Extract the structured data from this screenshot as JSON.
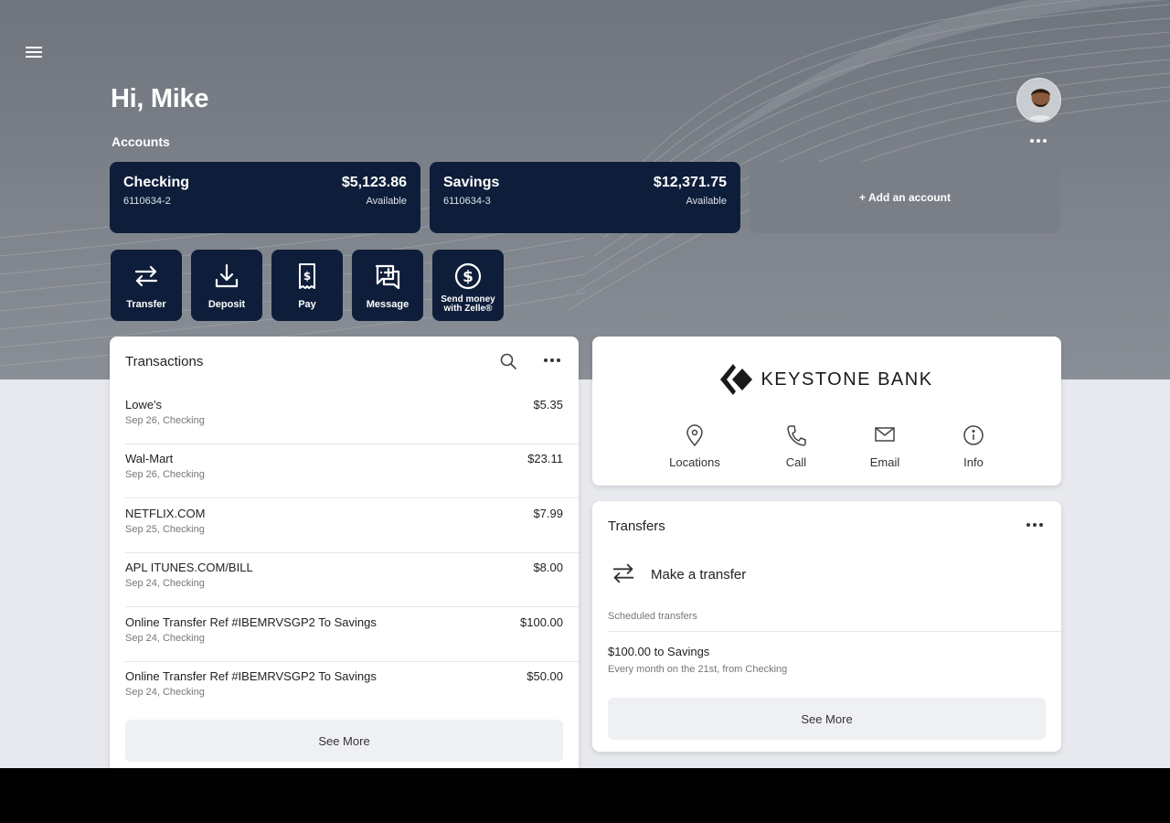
{
  "header": {
    "greeting": "Hi, Mike",
    "accounts_label": "Accounts"
  },
  "accounts": [
    {
      "name": "Checking",
      "number": "6110634-2",
      "balance": "$5,123.86",
      "balance_label": "Available"
    },
    {
      "name": "Savings",
      "number": "6110634-3",
      "balance": "$12,371.75",
      "balance_label": "Available"
    }
  ],
  "add_account_label": "+ Add an account",
  "quick_actions": [
    {
      "label": "Transfer",
      "icon": "transfer-icon"
    },
    {
      "label": "Deposit",
      "icon": "deposit-icon"
    },
    {
      "label": "Pay",
      "icon": "pay-icon"
    },
    {
      "label": "Message",
      "icon": "message-icon"
    },
    {
      "label": "Send money with Zelle®",
      "icon": "zelle-dollar-icon"
    }
  ],
  "transactions": {
    "title": "Transactions",
    "items": [
      {
        "description": "Lowe's",
        "detail": "Sep 26, Checking",
        "amount": "$5.35"
      },
      {
        "description": "Wal-Mart",
        "detail": "Sep 26, Checking",
        "amount": "$23.11"
      },
      {
        "description": "NETFLIX.COM",
        "detail": "Sep 25, Checking",
        "amount": "$7.99"
      },
      {
        "description": "APL ITUNES.COM/BILL",
        "detail": "Sep 24, Checking",
        "amount": "$8.00"
      },
      {
        "description": "Online Transfer Ref #IBEMRVSGP2 To Savings",
        "detail": "Sep 24, Checking",
        "amount": "$100.00"
      },
      {
        "description": "Online Transfer Ref #IBEMRVSGP2 To Savings",
        "detail": "Sep 24, Checking",
        "amount": "$50.00"
      }
    ],
    "see_more_label": "See More"
  },
  "bank": {
    "name": "KEYSTONE BANK",
    "contacts": [
      {
        "label": "Locations",
        "icon": "location-pin-icon"
      },
      {
        "label": "Call",
        "icon": "phone-icon"
      },
      {
        "label": "Email",
        "icon": "email-icon"
      },
      {
        "label": "Info",
        "icon": "info-icon"
      }
    ]
  },
  "transfers": {
    "title": "Transfers",
    "make_transfer_label": "Make a transfer",
    "scheduled_label": "Scheduled transfers",
    "scheduled": [
      {
        "title": "$100.00 to Savings",
        "detail": "Every month on the 21st, from Checking"
      }
    ],
    "see_more_label": "See More"
  },
  "colors": {
    "navy": "#0e1e3a",
    "hero_gray": "#7a7f88",
    "page_bg": "#e7e9ee"
  }
}
